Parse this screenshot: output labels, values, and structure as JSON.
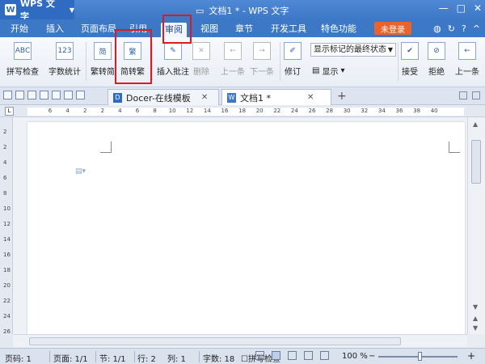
{
  "titlebar": {
    "app_name": "WPS 文字",
    "logo_letter": "W",
    "window_title": "文档1 * - WPS 文字"
  },
  "menu": {
    "tabs": [
      {
        "label": "开始"
      },
      {
        "label": "插入"
      },
      {
        "label": "页面布局"
      },
      {
        "label": "引用"
      },
      {
        "label": "审阅"
      },
      {
        "label": "视图"
      },
      {
        "label": "章节"
      },
      {
        "label": "开发工具"
      },
      {
        "label": "特色功能"
      }
    ],
    "active_tab": "审阅",
    "login_label": "未登录"
  },
  "ribbon": {
    "spell_check": "拼写检查",
    "word_count": "字数统计",
    "trad_to_simp": "繁转简",
    "simp_to_trad": "简转繁",
    "insert_comment": "插入批注",
    "delete": "删除",
    "prev": "上一条",
    "next": "下一条",
    "track_changes": "修订",
    "display_mode": "显示标记的最终状态",
    "show": "显示",
    "accept": "接受",
    "reject": "拒绝",
    "prev2": "上一条",
    "icon_abc": "ABC",
    "icon_123": "123",
    "icon_jian": "简",
    "icon_fan": "繁"
  },
  "doc_tabs": {
    "tabs": [
      {
        "label": "Docer-在线模板"
      },
      {
        "label": "文档1 *"
      }
    ]
  },
  "ruler": {
    "ticks": [
      "6",
      "4",
      "2",
      "2",
      "4",
      "6",
      "8",
      "10",
      "12",
      "14",
      "16",
      "18",
      "20",
      "22",
      "24",
      "26",
      "28",
      "30",
      "32",
      "34",
      "36",
      "38",
      "40"
    ],
    "vticks": [
      "2",
      "2",
      "4",
      "6",
      "8",
      "10",
      "12",
      "14",
      "16",
      "18",
      "20",
      "22",
      "24",
      "26"
    ]
  },
  "status": {
    "page_code": "页码: 1",
    "pages": "页面: 1/1",
    "section": "节: 1/1",
    "row": "行: 2",
    "col": "列: 1",
    "words": "字数: 18",
    "spell_check": "拼写检查",
    "zoom": "100 %",
    "zoom_level": 0.52
  },
  "colors": {
    "accent": "#3d78c7",
    "highlight": "#e0191f",
    "login": "#e8642c"
  }
}
